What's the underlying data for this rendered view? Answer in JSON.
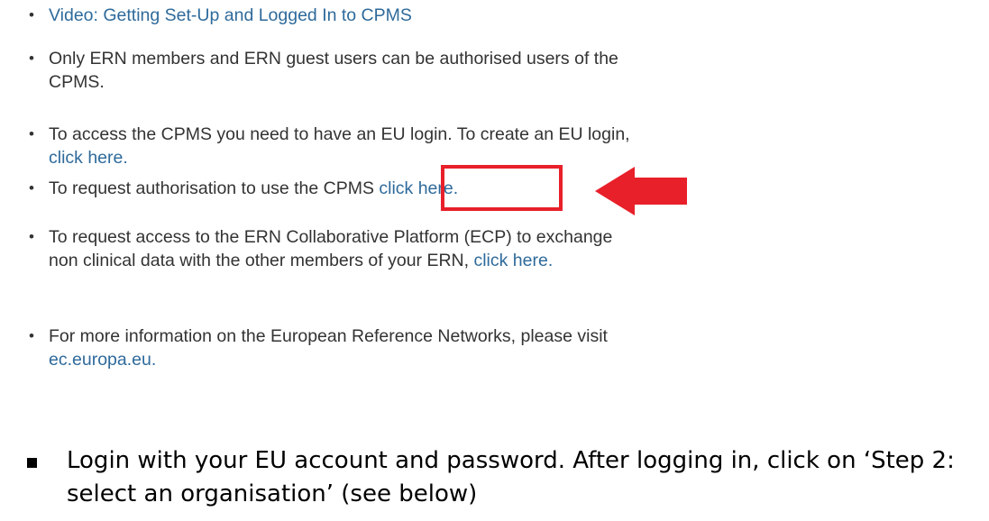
{
  "web_list": {
    "items": [
      {
        "parts": [
          {
            "text": "Video: Getting Set-Up and Logged In to CPMS",
            "link": true
          }
        ]
      },
      {
        "parts": [
          {
            "text": "Only ERN members and ERN guest users can be authorised users of the CPMS.",
            "link": false
          }
        ]
      },
      {
        "parts": [
          {
            "text": "To access the CPMS you need to have an EU login. To create an EU login, ",
            "link": false
          },
          {
            "text": "click here.",
            "link": true
          }
        ]
      },
      {
        "parts": [
          {
            "text": "To request authorisation to use the CPMS ",
            "link": false
          },
          {
            "text": "click here.",
            "link": true
          }
        ]
      },
      {
        "parts": [
          {
            "text": "To request access to the ERN Collaborative Platform (ECP) to exchange non clinical data with the other members of your ERN, ",
            "link": false
          },
          {
            "text": "click here.",
            "link": true
          }
        ]
      },
      {
        "parts": [
          {
            "text": "For more information on the European Reference Networks, please visit ",
            "link": false
          },
          {
            "text": "ec.europa.eu.",
            "link": true
          }
        ]
      }
    ]
  },
  "annotation": {
    "highlight_color": "#e8202a",
    "arrow_icon": "arrow-left-icon"
  },
  "slide_bullet": {
    "text": "Login with your EU account and password. After logging in, click on ‘Step 2: select an organisation’ (see below)"
  },
  "colors": {
    "link": "#2e6a9b",
    "body_text": "#333333"
  }
}
